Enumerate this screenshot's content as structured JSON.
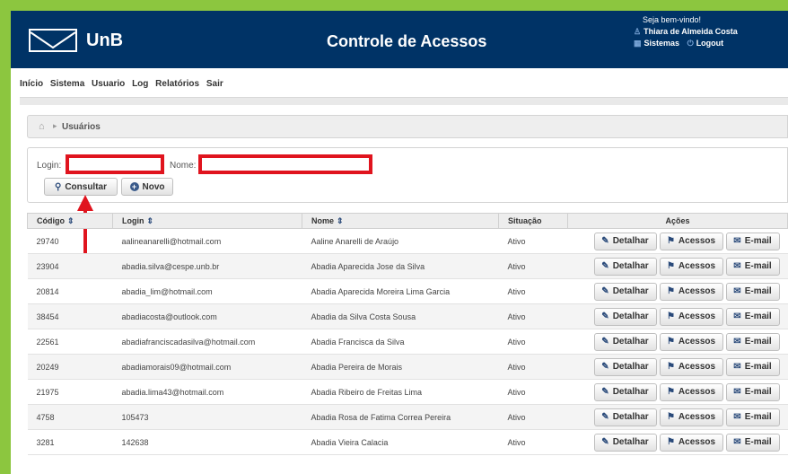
{
  "header": {
    "logo_text": "UnB",
    "title": "Controle de Acessos",
    "welcome": "Seja bem-vindo!",
    "user_name": "Thiara de Almeida Costa",
    "systems_label": "Sistemas",
    "logout_label": "Logout"
  },
  "menu": [
    "Início",
    "Sistema",
    "Usuario",
    "Log",
    "Relatórios",
    "Sair"
  ],
  "breadcrumb": {
    "current": "Usuários"
  },
  "filter": {
    "login_label": "Login:",
    "login_value": "",
    "name_label": "Nome:",
    "name_value": "",
    "consultar_label": "Consultar",
    "novo_label": "Novo"
  },
  "table": {
    "headers": [
      "Código",
      "Login",
      "Nome",
      "Situação",
      "Ações"
    ],
    "rows": [
      [
        "29740",
        "aalineanarelli@hotmail.com",
        "Aaline Anarelli de Araújo",
        "Ativo"
      ],
      [
        "23904",
        "abadia.silva@cespe.unb.br",
        "Abadia Aparecida Jose da Silva",
        "Ativo"
      ],
      [
        "20814",
        "abadia_lim@hotmail.com",
        "Abadia Aparecida Moreira Lima Garcia",
        "Ativo"
      ],
      [
        "38454",
        "abadiacosta@outlook.com",
        "Abadia da Silva Costa Sousa",
        "Ativo"
      ],
      [
        "22561",
        "abadiafranciscadasilva@hotmail.com",
        "Abadia Francisca da Silva",
        "Ativo"
      ],
      [
        "20249",
        "abadiamorais09@hotmail.com",
        "Abadia Pereira de Morais",
        "Ativo"
      ],
      [
        "21975",
        "abadia.lima43@hotmail.com",
        "Abadia Ribeiro de Freitas Lima",
        "Ativo"
      ],
      [
        "4758",
        "105473",
        "Abadia Rosa de Fatima Correa Pereira",
        "Ativo"
      ],
      [
        "3281",
        "142638",
        "Abadia Vieira Calacia",
        "Ativo"
      ]
    ],
    "actions": {
      "detalhar": "Detalhar",
      "acessos": "Acessos",
      "email": "E-mail"
    }
  },
  "colors": {
    "header_bg": "#003366",
    "frame_bg": "#8cc63f",
    "highlight": "#e0141e"
  }
}
